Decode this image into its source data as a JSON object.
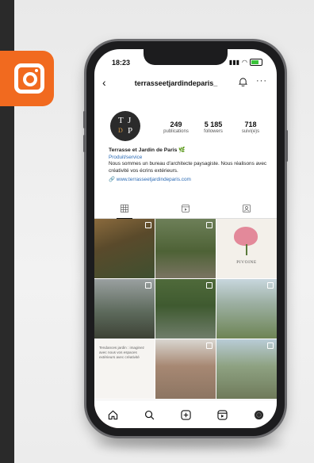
{
  "status": {
    "time": "18:23"
  },
  "profile": {
    "username": "terrasseetjardindeparis_",
    "avatar_letters": [
      "T",
      "J",
      "D",
      "P"
    ],
    "stats": [
      {
        "value": "249",
        "label": "publications"
      },
      {
        "value": "5 185",
        "label": "followers"
      },
      {
        "value": "718",
        "label": "suivi(e)s"
      }
    ],
    "bio": {
      "name": "Terrasse et Jardin de Paris 🌿",
      "category": "Produit/service",
      "description": "Nous sommes un bureau d'architecte paysagiste. Nous réalisons avec créativité vos écrins extérieurs.",
      "link": "www.terrasseetjardindeparis.com"
    }
  },
  "grid": {
    "pivoine_label": "PIVOINE",
    "text_post": "Tendances jardin : imaginez avec nous vos espaces extérieurs avec créativité"
  },
  "colors": {
    "instagram_badge": "#f16a1f",
    "link": "#2c6bb5"
  }
}
